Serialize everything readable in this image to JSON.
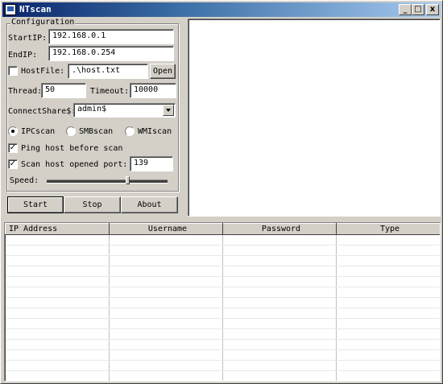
{
  "window": {
    "title": "NTscan",
    "controls": {
      "minimize": "_",
      "maximize": "□",
      "close": "x"
    }
  },
  "config": {
    "group_title": "Configuration",
    "start_ip_label": "StartIP:",
    "start_ip_value": "192.168.0.1",
    "end_ip_label": "EndIP:",
    "end_ip_value": "192.168.0.254",
    "hostfile_label": "HostFile:",
    "hostfile_checked": false,
    "hostfile_value": ".\\host.txt",
    "open_button": "Open",
    "thread_label": "Thread:",
    "thread_value": "50",
    "timeout_label": "Timeout:",
    "timeout_value": "10000",
    "connectshare_label": "ConnectShare$:",
    "connectshare_value": "admin$",
    "scan_modes": [
      {
        "label": "IPCscan",
        "selected": true
      },
      {
        "label": "SMBscan",
        "selected": false
      },
      {
        "label": "WMIscan",
        "selected": false
      }
    ],
    "ping_label": "Ping host before scan",
    "ping_checked": true,
    "port_label": "Scan host opened port:",
    "port_checked": true,
    "port_value": "139",
    "speed_label": "Speed:",
    "speed_level": 0.67
  },
  "actions": {
    "start": "Start",
    "stop": "Stop",
    "about": "About"
  },
  "results": {
    "columns": [
      "IP Address",
      "Username",
      "Password",
      "Type"
    ],
    "rows": []
  },
  "colors": {
    "face": "#d4d0c8",
    "title_from": "#0a246a",
    "title_to": "#a6caf0"
  }
}
